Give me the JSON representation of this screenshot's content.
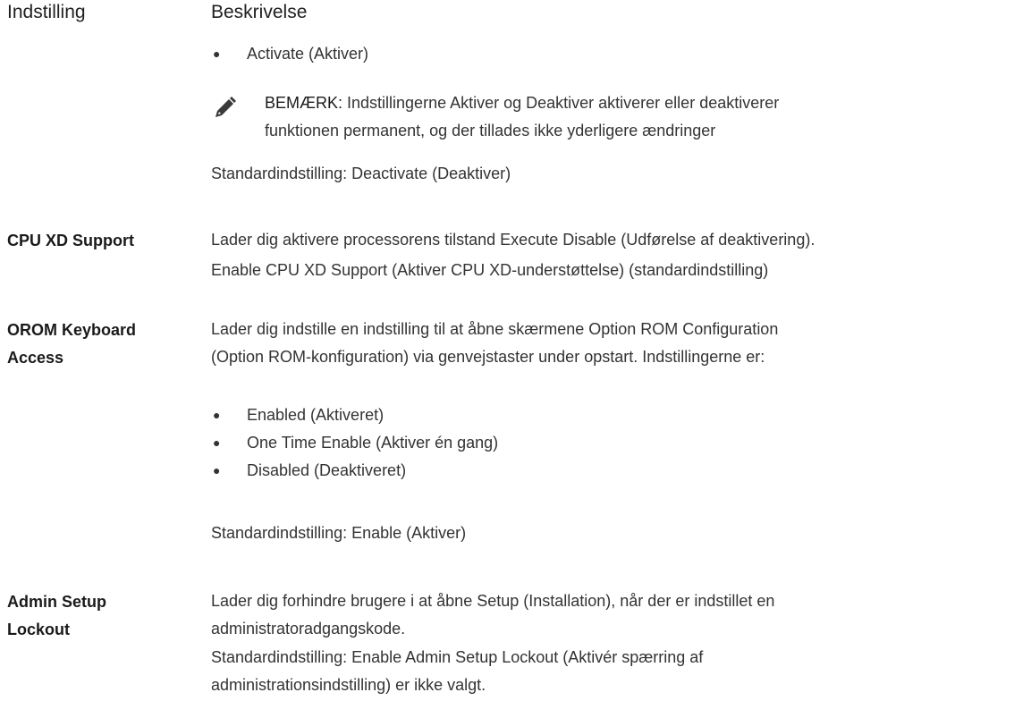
{
  "header": {
    "setting": "Indstilling",
    "description": "Beskrivelse"
  },
  "security_freeze": {
    "bullet_activate": "Activate (Aktiver)",
    "note_label": "BEMÆRK:",
    "note_line1": " Indstillingerne Aktiver og Deaktiver aktiverer eller deaktiverer",
    "note_line2": "funktionen permanent, og der tillades ikke yderligere ændringer",
    "default": "Standardindstilling: Deactivate (Deaktiver)"
  },
  "cpu_xd": {
    "name": "CPU XD Support",
    "line1": "Lader dig aktivere processorens tilstand Execute Disable (Udførelse af deaktivering).",
    "line2": "Enable CPU XD Support (Aktiver CPU XD-understøttelse) (standardindstilling)"
  },
  "orom": {
    "name_line1": "OROM Keyboard",
    "name_line2": "Access",
    "line1": "Lader dig indstille en indstilling til at åbne skærmene Option ROM Configuration",
    "line2": "(Option ROM-konfiguration) via genvejstaster under opstart. Indstillingerne er:",
    "options": [
      "Enabled (Aktiveret)",
      "One Time Enable (Aktiver én gang)",
      "Disabled (Deaktiveret)"
    ],
    "default": "Standardindstilling: Enable (Aktiver)"
  },
  "admin_lockout": {
    "name_line1": "Admin Setup",
    "name_line2": "Lockout",
    "line1": "Lader dig forhindre brugere i at åbne Setup (Installation), når der er indstillet en",
    "line2": "administratoradgangskode.",
    "line3": "Standardindstilling: Enable Admin Setup Lockout (Aktivér spærring af",
    "line4": "administrationsindstilling) er ikke valgt."
  },
  "icons": {
    "note": "pencil-note-icon"
  }
}
